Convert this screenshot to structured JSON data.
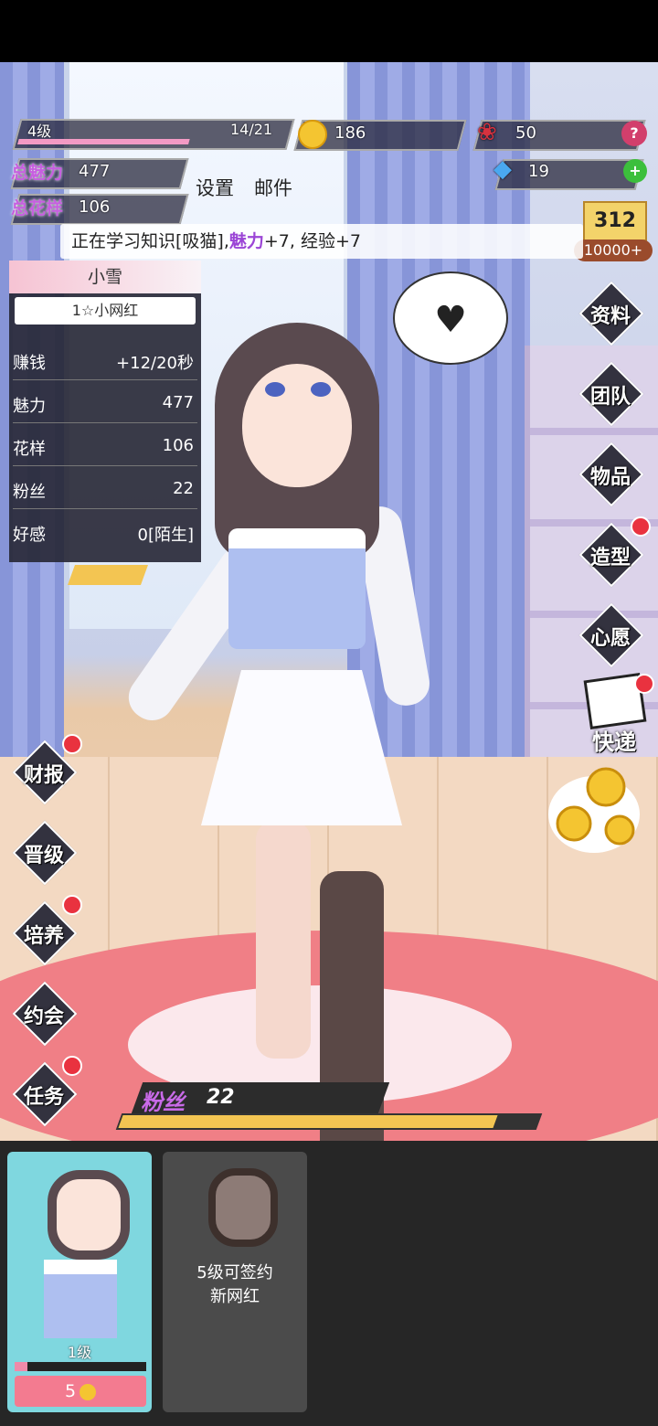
{
  "hud": {
    "level": "4级",
    "exp": "14/21",
    "exp_fraction": 0.667,
    "coins": "186",
    "roses": "50",
    "gems": "19",
    "total_charm_label": "总魅力",
    "total_charm": "477",
    "total_style_label": "总花样",
    "total_style": "106",
    "settings": "设置",
    "mail": "邮件",
    "ranking": "10000+"
  },
  "notice": {
    "prefix": "正在学习知识[吸猫],",
    "highlight": "魅力",
    "suffix": "+7, 经验+7"
  },
  "info": {
    "name": "小雪",
    "rank": "1☆小网红",
    "rows": [
      {
        "k": "赚钱",
        "v": "+12/20秒"
      },
      {
        "k": "魅力",
        "v": "477"
      },
      {
        "k": "花样",
        "v": "106"
      },
      {
        "k": "粉丝",
        "v": "22"
      },
      {
        "k": "好感",
        "v": "0[陌生]"
      }
    ]
  },
  "right_menu": [
    "资料",
    "团队",
    "物品",
    "造型",
    "心愿"
  ],
  "express": "快递",
  "left_menu": [
    "财报",
    "晋级",
    "培养",
    "约会",
    "任务"
  ],
  "fans": {
    "label": "粉丝",
    "value": "22",
    "fraction": 0.9
  },
  "cards": {
    "card1_level": "1级",
    "card1_progress": 0.1,
    "card1_price": "5",
    "card2_msg1": "5级可签约",
    "card2_msg2": "新网红"
  }
}
